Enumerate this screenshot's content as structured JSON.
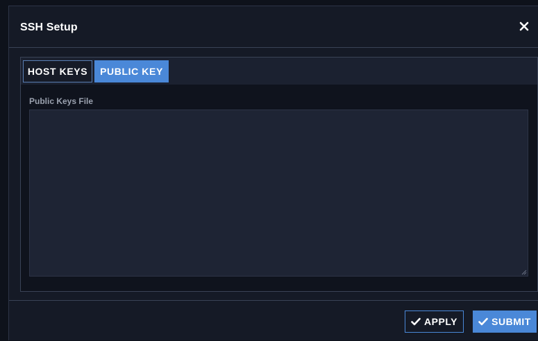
{
  "dialog": {
    "title": "SSH Setup",
    "close_icon": "close-icon"
  },
  "tabs": [
    {
      "label": "HOST KEYS",
      "active": false
    },
    {
      "label": "PUBLIC KEY",
      "active": true
    }
  ],
  "public_key": {
    "label": "Public Keys File",
    "value": ""
  },
  "footer": {
    "apply_label": "APPLY",
    "submit_label": "SUBMIT",
    "button_icon": "check-icon"
  },
  "colors": {
    "accent": "#4a88d8",
    "background": "#151a26",
    "field": "#1e2434"
  }
}
